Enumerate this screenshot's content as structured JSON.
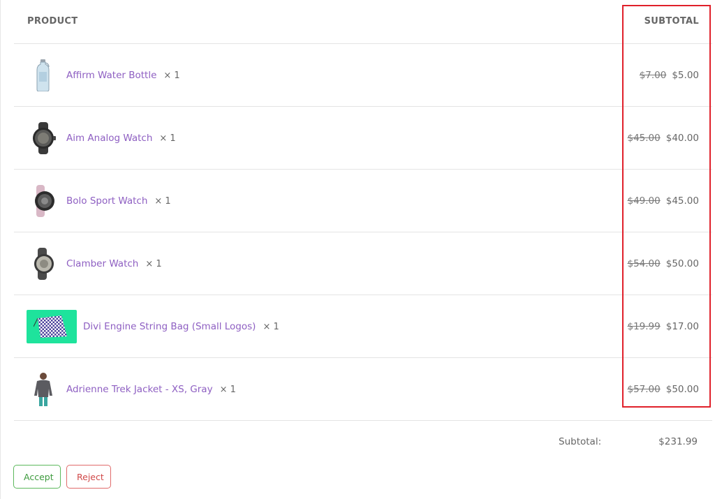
{
  "header": {
    "product": "PRODUCT",
    "subtotal": "SUBTOTAL"
  },
  "items": [
    {
      "name": "Affirm Water Bottle",
      "qty": "× 1",
      "old_price": "$7.00",
      "price": "$5.00",
      "thumb": "water-bottle-icon"
    },
    {
      "name": "Aim Analog Watch",
      "qty": "× 1",
      "old_price": "$45.00",
      "price": "$40.00",
      "thumb": "watch-icon"
    },
    {
      "name": "Bolo Sport Watch",
      "qty": "× 1",
      "old_price": "$49.00",
      "price": "$45.00",
      "thumb": "watch-icon"
    },
    {
      "name": "Clamber Watch",
      "qty": "× 1",
      "old_price": "$54.00",
      "price": "$50.00",
      "thumb": "watch-icon"
    },
    {
      "name": "Divi Engine String Bag (Small Logos)",
      "qty": "× 1",
      "old_price": "$19.99",
      "price": "$17.00",
      "thumb": "string-bag-icon"
    },
    {
      "name": "Adrienne Trek Jacket - XS, Gray",
      "qty": "× 1",
      "old_price": "$57.00",
      "price": "$50.00",
      "thumb": "jacket-icon"
    }
  ],
  "summary": {
    "label": "Subtotal:",
    "value": "$231.99"
  },
  "actions": {
    "accept": "Accept",
    "reject": "Reject"
  },
  "colors": {
    "link": "#8e5fc2",
    "highlight": "#e0202a",
    "accept": "#5cb85c",
    "reject": "#e06a6a",
    "bag_bg": "#1ee39c"
  }
}
